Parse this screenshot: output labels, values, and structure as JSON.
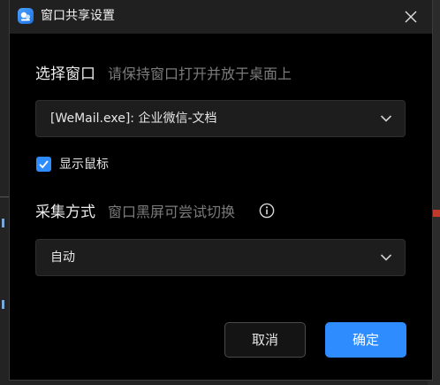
{
  "window": {
    "title": "窗口共享设置",
    "icon": "app-logo-icon",
    "close_icon": "close-icon"
  },
  "select_window": {
    "label": "选择窗口",
    "hint": "请保持窗口打开并放于桌面上",
    "value": "[WeMail.exe]: 企业微信-文档"
  },
  "show_cursor": {
    "label": "显示鼠标",
    "checked": true
  },
  "capture_mode": {
    "label": "采集方式",
    "hint": "窗口黑屏可尝试切换",
    "info_icon": "info-icon",
    "value": "自动"
  },
  "buttons": {
    "cancel": "取消",
    "ok": "确定"
  },
  "colors": {
    "accent": "#2f8cff",
    "dialog_bg": "#000000",
    "titlebar_bg": "#202020",
    "field_bg": "#1d1d1d",
    "hint_text": "#7b7b7b"
  }
}
